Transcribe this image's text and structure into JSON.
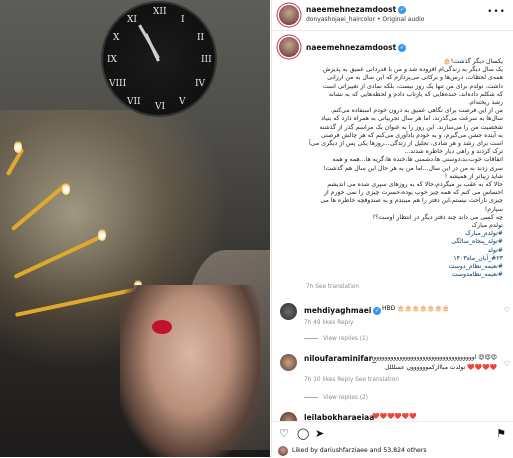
{
  "photo": {
    "clock_numerals": [
      "XII",
      "I",
      "II",
      "III",
      "IV",
      "V",
      "VI",
      "VII",
      "VIII",
      "IX",
      "X",
      "XI"
    ]
  },
  "post": {
    "username": "naeemehnezamdoost",
    "audio_line": "donyashojaei_haircolor • Original audio",
    "caption_lines": [
      "یکسال دیگر گذشت!🎂",
      "یک سال دیگر به زندگی‌ام افزوده شد و من با قدردانی عمیق به پذیرش",
      "همه‌ی لحظات، درس‌ها و برکاتی می‌پردازم که این سال به من ارزانی",
      "داشت. تولدم برای من تنها یک روز نیست، بلکه نمادی از تغییراتی است",
      "که شکلم داده‌اند، خنده‌هایی که بازتاب دادم و لحظه‌هایی که به نشانه",
      "رشد ریخته‌ام.",
      "من از این فرصت برای نگاهی عمیق به درون خودم استفاده می‌کنم.",
      "سال‌ها به سرعت می‌گذرند، اما هر سال تجربیاتی به همراه دارد که بنیاد",
      "شخصیت من را می‌سازند. این روز را به عنوان یک مراسم گذر از گذشته",
      "به آینده جشن می‌گیرم، و به خودم یادآوری می‌کنم که هر چالش فرصتی",
      "است برای رشد و هر شادی، تجلیل از زندگی...روزها یکی پس از دیگری می‌آ",
      "ترک کردند و راهی دیار خاطره شدند...",
      "اتفاقات خوب،بد،دوستی ها،دشمنی ها،خنده ها،گریه ها...همه و همه",
      "سری زدند به من در این سال...اما من به هر حال این سال هم گذشت!",
      "شاید زیباتر از همیشه !",
      "حالا که به عقب بر میگردم،حالا که به روزهای سپری شده می اندیشم",
      "احساس می کنم که همه چیز خوب بوده،حسرت چیزی را نمی خورم از",
      "چیزی ناراحت نیستم،این دفتر را هم میبندم و به صندوقچه خاطره ها می",
      "سپارم!",
      "چه کسی می داند چند دفتر دیگر در انتظار اوست؟!",
      "تولدم مبارک"
    ],
    "hashtags": [
      "#تولدم_مبارک",
      "#تولد_پنجاه_سالگی",
      "#تولد",
      "#۲۳_آبان_ماه۱۴۰۳",
      "#نعیمه_نظام_دوست",
      "#نعیمه_نظامدوست"
    ],
    "caption_meta": "7h   See translation"
  },
  "comments": [
    {
      "username": "mehdiyaghmaei",
      "text": "HBD 🎂🎂🎂🎂🎂🎂🎂",
      "meta": "7h   49 likes   Reply",
      "replies": "View replies (1)"
    },
    {
      "username": "niloufaraminifar_",
      "text": "😍😍😍 اوووووووووووووووووووووووووووووووووووووووووووووووووو",
      "text2": "❤️❤️❤️❤️ تولدت مبااارکموووووون عسلللل",
      "meta": "7h   10 likes   Reply   See translation",
      "replies": "View replies (2)"
    },
    {
      "username": "leilabokharaeiaa",
      "text": "❤️❤️❤️❤️❤️❤️"
    }
  ],
  "footer": {
    "likes_text": "Liked by dariushfarziaee and 53,824 others"
  }
}
